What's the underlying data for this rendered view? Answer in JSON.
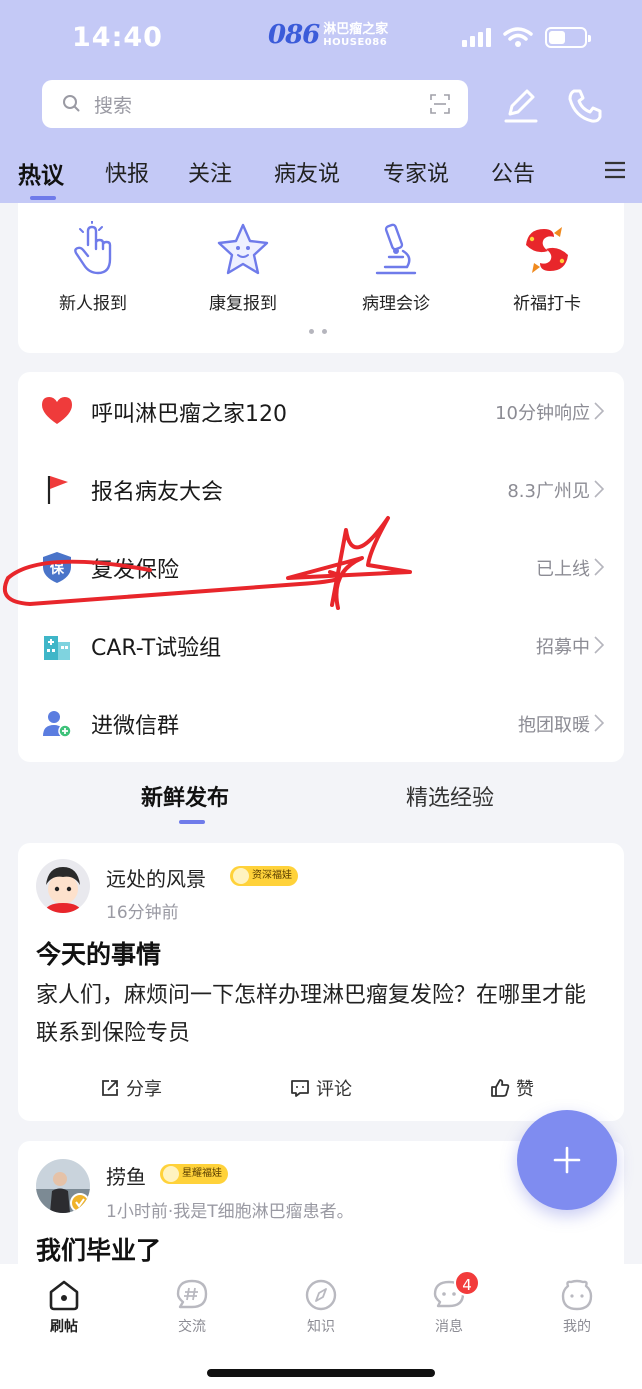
{
  "status_bar": {
    "time": "14:40"
  },
  "brand": {
    "logo": "086",
    "name_cn": "淋巴瘤之家",
    "name_en": "HOUSE086"
  },
  "search": {
    "placeholder": "搜索"
  },
  "tabs": [
    {
      "label": "热议",
      "active": true
    },
    {
      "label": "快报"
    },
    {
      "label": "关注"
    },
    {
      "label": "病友说"
    },
    {
      "label": "专家说"
    },
    {
      "label": "公告"
    }
  ],
  "quick_actions": [
    {
      "label": "新人报到",
      "icon": "tap-hand-icon"
    },
    {
      "label": "康复报到",
      "icon": "star-face-icon"
    },
    {
      "label": "病理会诊",
      "icon": "microscope-icon"
    },
    {
      "label": "祈福打卡",
      "icon": "koi-fish-icon"
    }
  ],
  "services": [
    {
      "label": "呼叫淋巴瘤之家120",
      "status": "10分钟响应",
      "icon": "heart-icon",
      "color": "#ef3b3b"
    },
    {
      "label": "报名病友大会",
      "status": "8.3广州见",
      "icon": "flag-icon",
      "color": "#ef3b3b"
    },
    {
      "label": "复发保险",
      "status": "已上线",
      "icon": "shield-icon",
      "icon_text": "保",
      "color": "#4a74c9"
    },
    {
      "label": "CAR-T试验组",
      "status": "招募中",
      "icon": "hospital-icon",
      "color": "#3fb6c8"
    },
    {
      "label": "进微信群",
      "status": "抱团取暖",
      "icon": "user-group-icon",
      "color": "#5b7de0"
    }
  ],
  "feed_tabs": [
    {
      "label": "新鲜发布",
      "active": true
    },
    {
      "label": "精选经验"
    }
  ],
  "posts": [
    {
      "author": "远处的风景",
      "badge": "资深福娃",
      "meta": "16分钟前",
      "title": "今天的事情",
      "body": "家人们，麻烦问一下怎样办理淋巴瘤复发险？在哪里才能联系到保险专员",
      "actions": {
        "share": "分享",
        "comment": "评论",
        "like": "赞"
      }
    },
    {
      "author": "捞鱼",
      "badge": "星耀福娃",
      "meta": "1小时前·我是T细胞淋巴瘤患者。",
      "title": "我们毕业了"
    }
  ],
  "fab": {
    "icon": "plus-icon"
  },
  "bottom_nav": [
    {
      "label": "刷帖",
      "icon": "home-icon",
      "active": true
    },
    {
      "label": "交流",
      "icon": "hash-chat-icon"
    },
    {
      "label": "知识",
      "icon": "compass-icon"
    },
    {
      "label": "消息",
      "icon": "message-icon",
      "badge": "4"
    },
    {
      "label": "我的",
      "icon": "profile-icon"
    }
  ],
  "colors": {
    "header_bg": "#c4c9f6",
    "accent": "#6f7bea",
    "fab": "#7f8cf0",
    "annotation_red": "#e8262b"
  }
}
